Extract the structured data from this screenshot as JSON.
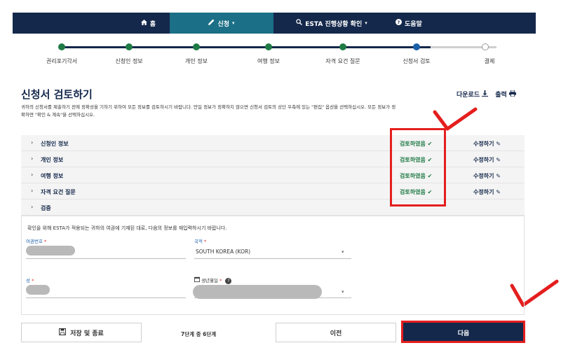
{
  "nav": {
    "home": "홈",
    "apply": "신청",
    "status": "ESTA 진행상황 확인",
    "help": "도움말"
  },
  "progress": {
    "steps": [
      "권리포기각서",
      "신청인 정보",
      "개인 정보",
      "여행 정보",
      "자격 요건 질문",
      "신청서 검토",
      "결제"
    ],
    "current_index": 5
  },
  "page": {
    "title": "신청서 검토하기",
    "download": "다운로드",
    "print": "출력",
    "description_line1": "귀하의 신청서를 제출하기 전에 정확성을 기하기 위하여 모든 정보를 검토하시기 바랍니다. 만일 정보가 정확하지 않으면 신청서 검토의 상단 우측에 있는 \"편집\" 옵션을 선택하십시오. 모든 정보가 정",
    "description_line2": "확하면 \"확인 & 계속\"을 선택하십시오."
  },
  "sections": [
    {
      "label": "신청인 정보",
      "reviewed": "검토하였음",
      "edit": "수정하기"
    },
    {
      "label": "개인 정보",
      "reviewed": "검토하였음",
      "edit": "수정하기"
    },
    {
      "label": "여행 정보",
      "reviewed": "검토하였음",
      "edit": "수정하기"
    },
    {
      "label": "자격 요건 질문",
      "reviewed": "검토하였음",
      "edit": "수정하기"
    },
    {
      "label": "검증",
      "reviewed": "",
      "edit": ""
    }
  ],
  "verify": {
    "description": "확인을 위해 ESTA가 적용되는 귀하의 여권에 기재된 대로, 다음의 정보를 재입력하시기 바랍니다.",
    "passport_label": "여권번호",
    "nationality_label": "국적",
    "nationality_value": "SOUTH KOREA (KOR)",
    "surname_label": "성",
    "dob_label": "생년월일",
    "required_mark": "*"
  },
  "footer": {
    "save": "저장 및 종료",
    "step_count": "7단계 중 6단계",
    "prev": "이전",
    "next": "다음"
  },
  "colors": {
    "nav_bg": "#14284b",
    "nav_active": "#1b6f86",
    "done_green": "#1f7a45",
    "annotation_red": "#e41e1e"
  }
}
